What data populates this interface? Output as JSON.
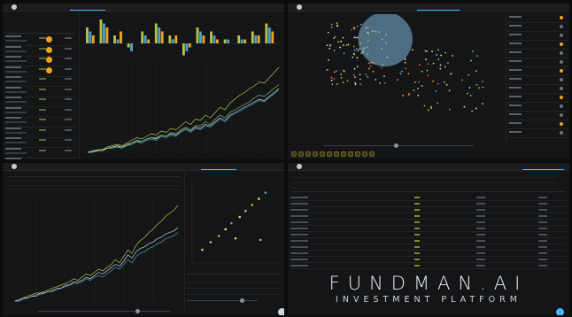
{
  "brand": {
    "name": "FUNDMAN.AI",
    "tagline": "INVESTMENT PLATFORM"
  },
  "colors": {
    "accent": "#49b6ff",
    "badge": "#f0a322",
    "highlight": "#d6cc5c",
    "bg": "#141516"
  },
  "icons": {
    "logo": "logo-icon",
    "fab_bottom_right": "play-icon",
    "fab_bottom_mid": "settings-icon"
  },
  "panels": {
    "top_left": {
      "tabs": [
        "",
        "",
        "",
        "",
        "",
        ""
      ],
      "chart_data": {
        "type": "line",
        "series": [
          {
            "color": "#b7c24a",
            "values": [
              10,
              11,
              12,
              12,
              14,
              15,
              16,
              15,
              17,
              19,
              21,
              20,
              22,
              24,
              23,
              26,
              25,
              28,
              27,
              30,
              33,
              31,
              35,
              34,
              38,
              36,
              40,
              44,
              42,
              47,
              50,
              53,
              55,
              58,
              60,
              63,
              62,
              66,
              70,
              74
            ]
          },
          {
            "color": "#4aa3c8",
            "values": [
              10,
              10,
              11,
              12,
              13,
              13,
              14,
              13,
              15,
              16,
              18,
              17,
              19,
              20,
              19,
              22,
              21,
              23,
              22,
              25,
              27,
              25,
              28,
              27,
              30,
              29,
              32,
              35,
              33,
              37,
              39,
              41,
              43,
              45,
              47,
              49,
              48,
              51,
              54,
              57
            ]
          },
          {
            "color": "#c9cdd1",
            "values": [
              10,
              11,
              11,
              12,
              13,
              14,
              15,
              14,
              16,
              17,
              19,
              18,
              20,
              21,
              20,
              23,
              22,
              24,
              23,
              26,
              28,
              26,
              29,
              28,
              31,
              30,
              33,
              36,
              34,
              38,
              40,
              42,
              44,
              46,
              48,
              50,
              49,
              52,
              55,
              58
            ]
          },
          {
            "color": "#7bc36a",
            "values": [
              10,
              10,
              12,
              11,
              13,
              14,
              14,
              14,
              15,
              17,
              18,
              18,
              20,
              21,
              21,
              23,
              22,
              25,
              24,
              27,
              29,
              27,
              30,
              30,
              33,
              31,
              35,
              38,
              36,
              40,
              42,
              44,
              46,
              48,
              51,
              53,
              52,
              55,
              58,
              61
            ]
          }
        ]
      },
      "bar_data": {
        "type": "bar",
        "series": [
          {
            "color": "#b7c24a",
            "values": [
              4,
              6,
              2,
              -1,
              3,
              5,
              2,
              -3,
              4,
              3,
              1,
              2,
              3,
              5
            ]
          },
          {
            "color": "#4aa3c8",
            "values": [
              3,
              5,
              1,
              -2,
              2,
              4,
              1,
              -2,
              3,
              2,
              1,
              1,
              2,
              4
            ]
          },
          {
            "color": "#f0a322",
            "values": [
              2,
              4,
              3,
              0,
              1,
              3,
              2,
              -1,
              2,
              1,
              0,
              1,
              2,
              3
            ]
          }
        ]
      }
    },
    "top_right": {
      "tabs": [
        "",
        "",
        "",
        "",
        ""
      ],
      "chart_data": {
        "type": "scatter",
        "highlight_circle": {
          "x": 0.45,
          "y": 0.8,
          "r": 0.13
        }
      }
    },
    "bottom_left": {
      "tabs": [
        "",
        "",
        "",
        "",
        "",
        ""
      ],
      "chart_data": {
        "type": "line",
        "series": [
          {
            "color": "#b7c24a",
            "values": [
              10,
              11,
              12,
              13,
              14,
              15,
              15,
              16,
              17,
              18,
              19,
              20,
              21,
              22,
              24,
              23,
              25,
              27,
              26,
              28,
              30,
              29,
              31,
              33,
              36,
              34,
              38,
              42,
              40,
              45,
              48,
              50,
              53,
              55,
              58,
              60,
              63,
              65,
              67,
              70
            ]
          },
          {
            "color": "#4aa3c8",
            "values": [
              10,
              11,
              11,
              12,
              13,
              14,
              14,
              15,
              16,
              17,
              17,
              18,
              19,
              20,
              21,
              21,
              22,
              24,
              23,
              25,
              26,
              25,
              27,
              29,
              31,
              30,
              33,
              36,
              34,
              38,
              40,
              41,
              43,
              44,
              46,
              47,
              49,
              50,
              51,
              53
            ]
          },
          {
            "color": "#c9cdd1",
            "values": [
              10,
              10,
              12,
              12,
              13,
              13,
              15,
              15,
              16,
              16,
              18,
              18,
              20,
              20,
              22,
              22,
              23,
              25,
              24,
              26,
              28,
              27,
              29,
              31,
              33,
              32,
              35,
              39,
              37,
              41,
              43,
              44,
              46,
              47,
              49,
              50,
              52,
              53,
              54,
              56
            ]
          }
        ]
      },
      "scatter_data": {
        "type": "scatter",
        "points": [
          [
            0.1,
            0.15
          ],
          [
            0.2,
            0.25
          ],
          [
            0.3,
            0.33
          ],
          [
            0.38,
            0.42
          ],
          [
            0.45,
            0.5
          ],
          [
            0.55,
            0.58
          ],
          [
            0.62,
            0.66
          ],
          [
            0.7,
            0.74
          ],
          [
            0.78,
            0.82
          ],
          [
            0.86,
            0.9
          ],
          [
            0.5,
            0.3
          ],
          [
            0.8,
            0.28
          ]
        ]
      }
    },
    "bottom_right": {
      "tabs": [
        "",
        "",
        "",
        "",
        ""
      ],
      "table_rows": 12
    }
  }
}
